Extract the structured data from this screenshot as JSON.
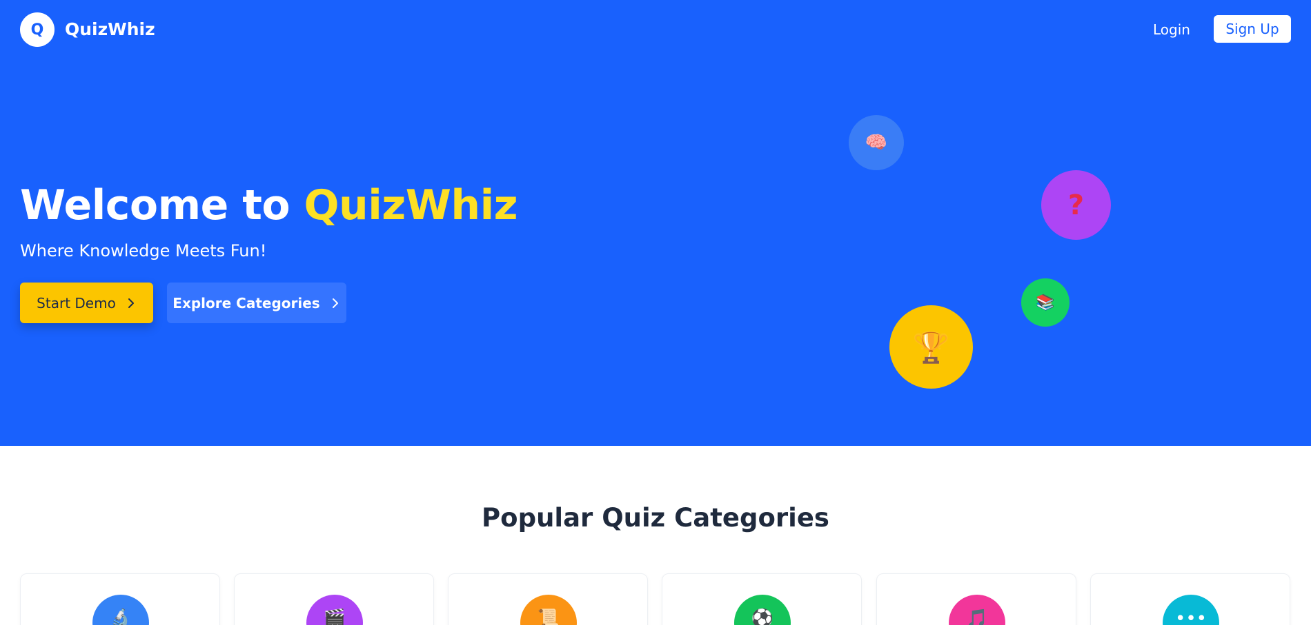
{
  "header": {
    "logo_letter": "Q",
    "brand_name": "QuizWhiz",
    "login_label": "Login",
    "signup_label": "Sign Up"
  },
  "hero": {
    "title_prefix": "Welcome to ",
    "title_accent": "QuizWhiz",
    "subtitle": "Where Knowledge Meets Fun!",
    "start_demo_label": "Start Demo",
    "explore_label": "Explore Categories",
    "bubbles": [
      {
        "icon": "brain-icon",
        "glyph": "🧠"
      },
      {
        "icon": "question-icon",
        "glyph": "?"
      },
      {
        "icon": "books-icon",
        "glyph": "📚"
      },
      {
        "icon": "trophy-icon",
        "glyph": "🏆"
      }
    ]
  },
  "categories": {
    "title": "Popular Quiz Categories",
    "items": [
      {
        "icon": "microscope-icon",
        "glyph": "🔬",
        "color": "#3583f6"
      },
      {
        "icon": "clapperboard-icon",
        "glyph": "🎬",
        "color": "#ad45f5"
      },
      {
        "icon": "scroll-icon",
        "glyph": "📜",
        "color": "#fb9414"
      },
      {
        "icon": "soccer-ball-icon",
        "glyph": "⚽",
        "color": "#14c45a"
      },
      {
        "icon": "music-note-icon",
        "glyph": "🎵",
        "color": "#f2369a"
      },
      {
        "icon": "more-icon",
        "glyph": "•••",
        "color": "#08bad6"
      }
    ]
  },
  "colors": {
    "brand_blue": "#1961fd",
    "accent_yellow": "#fde025",
    "button_yellow": "#fcc500"
  }
}
